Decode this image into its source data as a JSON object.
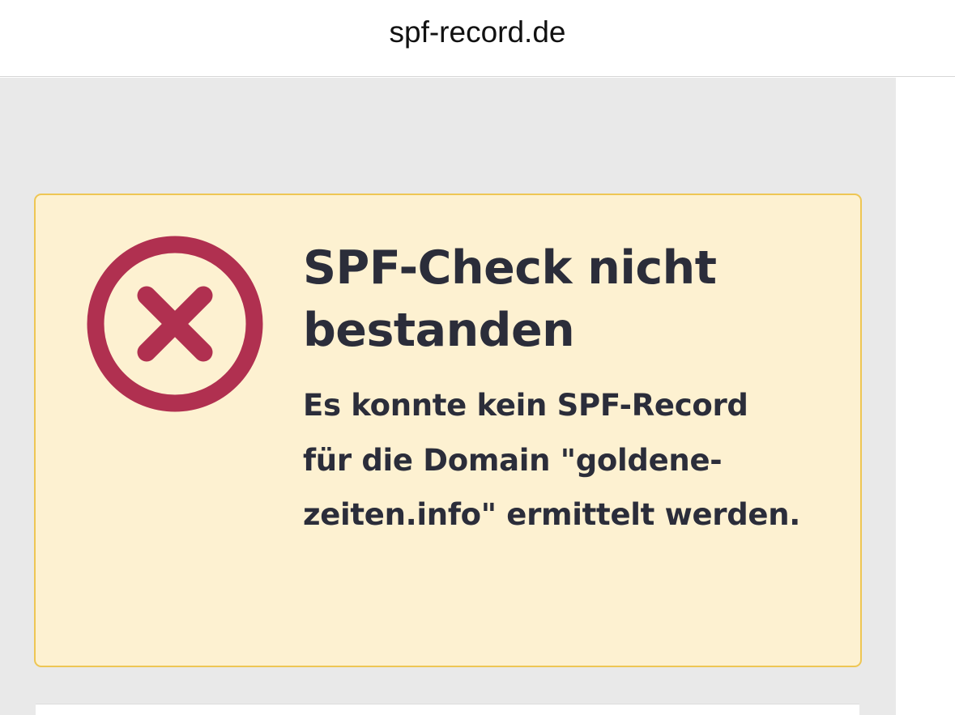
{
  "browser": {
    "url": "spf-record.de"
  },
  "alert": {
    "icon": "error-x-circle-icon",
    "title": "SPF-Check nicht bestanden",
    "message": "Es konnte kein SPF-Record für die Domain \"goldene-zeiten.info\" ermittelt werden."
  },
  "colors": {
    "alert_background": "#fdf1d1",
    "alert_border": "#eec654",
    "error_icon": "#b03050",
    "text": "#2b2d3a",
    "page_background": "#e9e9e9"
  }
}
